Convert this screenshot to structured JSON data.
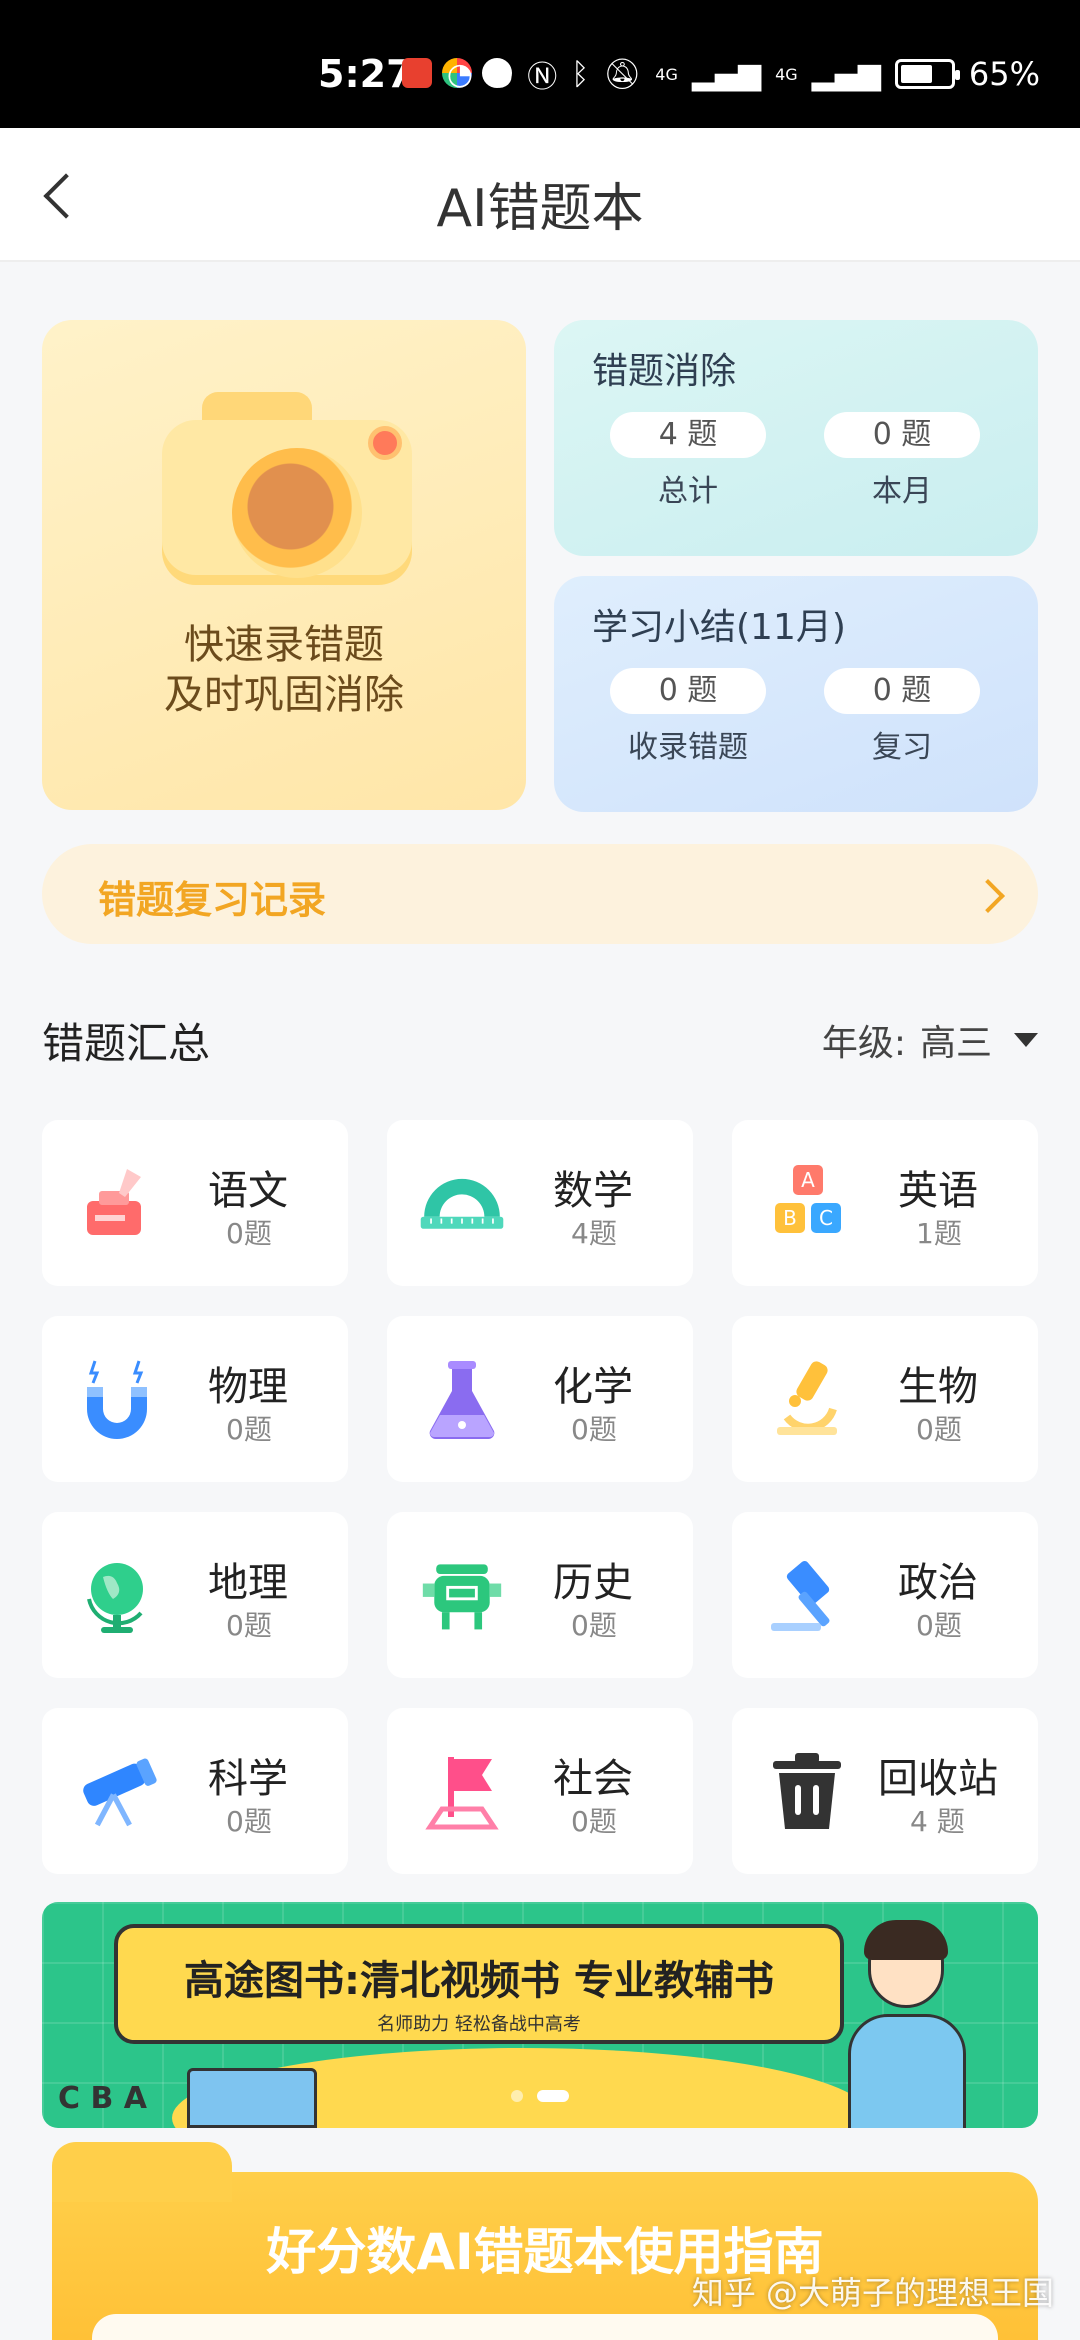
{
  "status_bar": {
    "time": "5:27",
    "network_left": "4G",
    "network_right": "4G",
    "battery": "65%",
    "battery_level": 0.65
  },
  "header": {
    "title": "AI错题本"
  },
  "capture_card": {
    "line1": "快速录错题",
    "line2": "及时巩固消除"
  },
  "elimination": {
    "title": "错题消除",
    "stats": [
      {
        "value": "4 题",
        "label": "总计"
      },
      {
        "value": "0 题",
        "label": "本月"
      }
    ]
  },
  "study_summary": {
    "title": "学习小结(11月)",
    "stats": [
      {
        "value": "0 题",
        "label": "收录错题"
      },
      {
        "value": "0 题",
        "label": "复习"
      }
    ]
  },
  "review_record": {
    "label": "错题复习记录"
  },
  "summary": {
    "title": "错题汇总",
    "grade_label": "年级:",
    "grade_value": "高三"
  },
  "subjects": [
    {
      "name": "语文",
      "count": "0题",
      "icon": "ink-bottle-icon",
      "color": "#ff6b6b"
    },
    {
      "name": "数学",
      "count": "4题",
      "icon": "protractor-icon",
      "color": "#2fc5a6"
    },
    {
      "name": "英语",
      "count": "1题",
      "icon": "abc-blocks-icon",
      "color": "#ff8a65"
    },
    {
      "name": "物理",
      "count": "0题",
      "icon": "magnet-icon",
      "color": "#3a8dff"
    },
    {
      "name": "化学",
      "count": "0题",
      "icon": "flask-icon",
      "color": "#8a6cf0"
    },
    {
      "name": "生物",
      "count": "0题",
      "icon": "microscope-icon",
      "color": "#ffc13b"
    },
    {
      "name": "地理",
      "count": "0题",
      "icon": "globe-icon",
      "color": "#2fcf8c"
    },
    {
      "name": "历史",
      "count": "0题",
      "icon": "bronze-vessel-icon",
      "color": "#2cc77d"
    },
    {
      "name": "政治",
      "count": "0题",
      "icon": "gavel-icon",
      "color": "#3a8dff"
    },
    {
      "name": "科学",
      "count": "0题",
      "icon": "telescope-icon",
      "color": "#2f86ff"
    },
    {
      "name": "社会",
      "count": "0题",
      "icon": "flag-icon",
      "color": "#ff4f8a"
    },
    {
      "name": "回收站",
      "count": "4 题",
      "icon": "trash-icon",
      "color": "#333333"
    }
  ],
  "banner": {
    "title": "高途图书:清北视频书 专业教辅书",
    "subtitle": "名师助力 轻松备战中高考",
    "letters": "C B A"
  },
  "guide": {
    "title": "好分数AI错题本使用指南"
  },
  "watermark": "知乎 @大萌子的理想王国"
}
